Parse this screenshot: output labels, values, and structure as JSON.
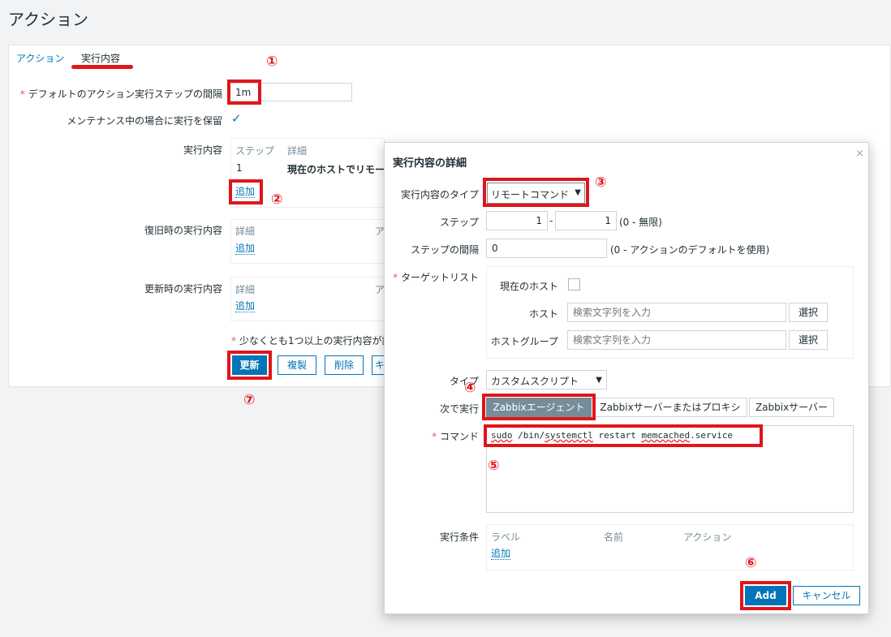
{
  "page": {
    "title": "アクション"
  },
  "tabs": [
    {
      "label": "アクション"
    },
    {
      "label": "実行内容"
    }
  ],
  "form": {
    "default_step_label": "デフォルトのアクション実行ステップの間隔",
    "default_step_value": "1m",
    "pause_maintenance_label": "メンテナンス中の場合に実行を保留",
    "pause_maintenance_checked": true,
    "operations_label": "実行内容",
    "operations_columns": [
      "ステップ",
      "詳細"
    ],
    "operations_row": {
      "step": "1",
      "detail": "現在のホストでリモー"
    },
    "add_link": "追加",
    "recovery_label": "復旧時の実行内容",
    "recovery_columns": [
      "詳細",
      "ア"
    ],
    "update_label": "更新時の実行内容",
    "update_columns": [
      "詳細",
      "ア"
    ],
    "footnote": "少なくとも1つ以上の実行内容が設",
    "buttons": {
      "update": "更新",
      "clone": "複製",
      "delete": "削除",
      "cancel": "キ"
    }
  },
  "modal": {
    "title": "実行内容の詳細",
    "close_icon": "×",
    "operation_type_label": "実行内容のタイプ",
    "operation_type_value": "リモートコマンド",
    "steps_label": "ステップ",
    "step_from": "1",
    "step_dash": "-",
    "step_to": "1",
    "steps_hint": "(0 - 無限)",
    "step_duration_label": "ステップの間隔",
    "step_duration_value": "0",
    "step_duration_hint": "(0 - アクションのデフォルトを使用)",
    "target_list_label": "ターゲットリスト",
    "current_host_label": "現在のホスト",
    "current_host_checked": false,
    "host_label": "ホスト",
    "host_placeholder": "検索文字列を入力",
    "hostgroup_label": "ホストグループ",
    "hostgroup_placeholder": "検索文字列を入力",
    "select_button": "選択",
    "type_label": "タイプ",
    "type_value": "カスタムスクリプト",
    "execute_on_label": "次で実行",
    "execute_on_options": [
      "Zabbixエージェント",
      "Zabbixサーバーまたはプロキシ",
      "Zabbixサーバー"
    ],
    "execute_on_selected": "Zabbixエージェント",
    "commands_label": "コマンド",
    "commands_value": [
      "sudo",
      " /bin/",
      "systemctl",
      " restart ",
      "memcached",
      ".service"
    ],
    "conditions_label": "実行条件",
    "conditions_columns": [
      "ラベル",
      "名前",
      "アクション"
    ],
    "conditions_add": "追加",
    "add_button": "Add",
    "cancel_button": "キャンセル"
  },
  "annotations": [
    "①",
    "②",
    "③",
    "④",
    "⑤",
    "⑥",
    "⑦"
  ],
  "colors": {
    "accent": "#0275b8",
    "highlight_red": "#e0161a",
    "required": "#e45959",
    "active_segment": "#768d99"
  }
}
